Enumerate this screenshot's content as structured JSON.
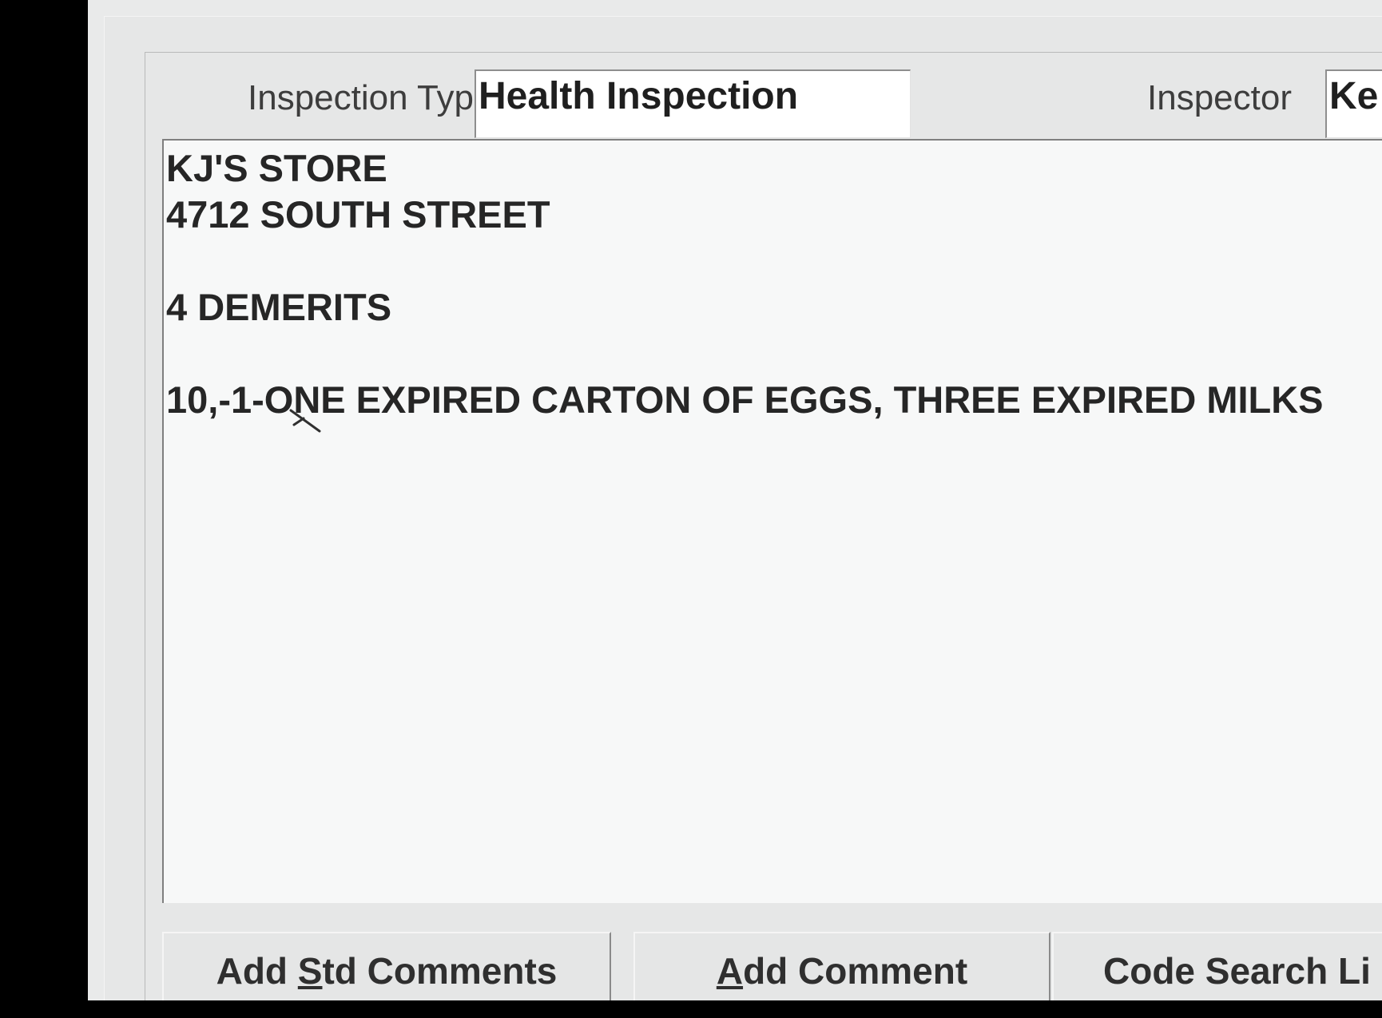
{
  "form": {
    "inspection_type_label": "Inspection Type",
    "inspection_type_value": "Health Inspection",
    "inspector_label": "Inspector",
    "inspector_value": "Ke"
  },
  "memo": {
    "lines": [
      "KJ'S STORE",
      "4712 SOUTH STREET",
      "",
      "4 DEMERITS",
      "",
      "10,-1-ONE EXPIRED CARTON OF EGGS, THREE EXPIRED MILKS"
    ]
  },
  "buttons": {
    "add_std_comments": {
      "before": "Add ",
      "accel": "S",
      "after": "td Comments"
    },
    "add_comment": {
      "before": "",
      "accel": "A",
      "after": "dd Comment"
    },
    "code_search": {
      "label": "Code Search Li"
    }
  }
}
